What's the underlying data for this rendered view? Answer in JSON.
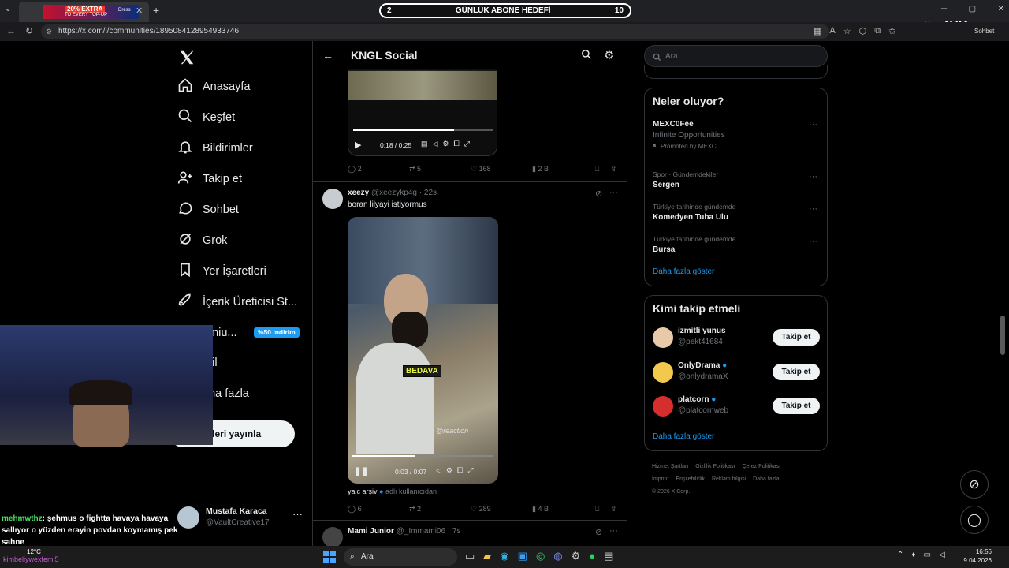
{
  "browser": {
    "url": "https://x.com/i/communities/1895084128954933746",
    "promo_tab": "20% EXTRA",
    "promo_sub": "TO EVERY TOP-UP",
    "promo_brand": "Dress"
  },
  "overlay": {
    "goal_left": "2",
    "goal_title": "GÜNLÜK ABONE HEDEFİ",
    "goal_right": "10",
    "brand_name": "AVM",
    "brand_prefix": "iter",
    "side_label": "Sohbet"
  },
  "nav": {
    "items": [
      {
        "label": "Anasayfa",
        "icon": "home-icon"
      },
      {
        "label": "Keşfet",
        "icon": "search-icon"
      },
      {
        "label": "Bildirimler",
        "icon": "bell-icon"
      },
      {
        "label": "Takip et",
        "icon": "person-add-icon"
      },
      {
        "label": "Sohbet",
        "icon": "chat-icon"
      },
      {
        "label": "Grok",
        "icon": "grok-icon"
      },
      {
        "label": "Yer İşaretleri",
        "icon": "bookmark-icon"
      },
      {
        "label": "İçerik Üreticisi St...",
        "icon": "rocket-icon"
      },
      {
        "label": "emiu...",
        "icon": "premium-icon"
      },
      {
        "label": "ofil",
        "icon": "profile-icon"
      },
      {
        "label": "aha fazla",
        "icon": "more-icon"
      }
    ],
    "premium_badge": "%50 indirim",
    "post_button": "nderi yayınla",
    "account": {
      "name": "Mustafa Karaca",
      "handle": "@VaultCreative17"
    }
  },
  "feed": {
    "title": "KNGL Social",
    "post1": {
      "time": "0:18 / 0:25",
      "replies": "2",
      "reposts": "5",
      "likes": "168",
      "views": "2 B"
    },
    "post2": {
      "name": "xeezy",
      "handle": "@xeezykp4g",
      "age": "· 22s",
      "text": "boran lilyayi istiyormus",
      "video_caption": "BEDAVA",
      "watermark": "@reaction",
      "time": "0:03 / 0:07",
      "credit_name": "yalc arşiv",
      "credit_note": "adlı kullanıcıdan",
      "replies": "6",
      "reposts": "2",
      "likes": "289",
      "views": "4 B"
    },
    "post3": {
      "name": "Mami Junior",
      "handle": "@_Immami06",
      "age": "· 7s"
    }
  },
  "right": {
    "search_placeholder": "Ara",
    "trends_title": "Neler oluyor?",
    "trends": [
      {
        "meta": "",
        "name": "MEXC0Fee",
        "sub": "Infinite Opportunities",
        "promo": "Promoted by MEXC"
      },
      {
        "meta": "Spor · Gündemdekiler",
        "name": "Sergen"
      },
      {
        "meta": "Türkiye tarihinde gündemde",
        "name": "Komedyen Tuba Ulu"
      },
      {
        "meta": "Türkiye tarihinde gündemde",
        "name": "Bursa"
      }
    ],
    "show_more": "Daha fazla göster",
    "follow_title": "Kimi takip etmeli",
    "follow": [
      {
        "name": "izmitli yunus",
        "handle": "@pekt41684",
        "verified": false,
        "color": "#e8c9a8"
      },
      {
        "name": "OnlyDrama",
        "handle": "@onlydramaX",
        "verified": true,
        "color": "#f2c94c"
      },
      {
        "name": "platcorn",
        "handle": "@platcornweb",
        "verified": true,
        "color": "#d62d2d"
      }
    ],
    "follow_button": "Takip et",
    "follow_more": "Daha fazla göster",
    "footer": [
      "Hizmet Şartları",
      "Gizlilik Politikası",
      "Çerez Politikası",
      "Imprint",
      "Erişilebilirlik",
      "Reklam bilgisi",
      "Daha fazla ...",
      "© 2026 X Corp."
    ]
  },
  "chat": {
    "user1": "mehmwthz",
    "msg1": ": şehmus o fightta havaya havaya sallıyor o yüzden erayin povdan koymamış pek sahne",
    "user2": "kimbeliywexfemi5",
    "weather": "12°C"
  },
  "taskbar": {
    "search": "Ara",
    "time": "16:56",
    "date": "9.04.2026"
  },
  "colors": {
    "accent": "#1d9bf0",
    "bg": "#000000",
    "border": "#2f3336"
  }
}
